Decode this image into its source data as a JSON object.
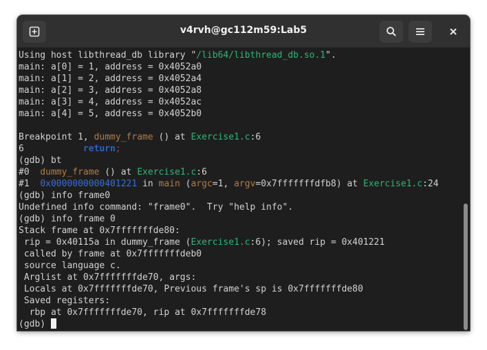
{
  "window": {
    "title": "v4rvh@gc112m59:Lab5",
    "buttons": {
      "new_tab_icon": "new-tab-icon",
      "search_icon": "search-icon",
      "menu_icon": "hamburger-menu-icon",
      "close_icon": "close-icon"
    }
  },
  "colors": {
    "filename": "#2fb57a",
    "function": "#b07d4a",
    "address": "#3a6fd6",
    "keyword": "#2a60c8",
    "terminal_bg": "#1e1e1e"
  },
  "terminal": {
    "lines": [
      [
        {
          "t": "Using host libthread_db library \""
        },
        {
          "t": "/lib64/libthread_db.so.1",
          "c": "green"
        },
        {
          "t": "\"."
        }
      ],
      [
        {
          "t": "main: a[0] = 1, address = 0x4052a0"
        }
      ],
      [
        {
          "t": "main: a[1] = 2, address = 0x4052a4"
        }
      ],
      [
        {
          "t": "main: a[2] = 3, address = 0x4052a8"
        }
      ],
      [
        {
          "t": "main: a[3] = 4, address = 0x4052ac"
        }
      ],
      [
        {
          "t": "main: a[4] = 5, address = 0x4052b0"
        }
      ],
      [
        {
          "t": ""
        }
      ],
      [
        {
          "t": "Breakpoint 1, "
        },
        {
          "t": "dummy_frame",
          "c": "brown"
        },
        {
          "t": " () at "
        },
        {
          "t": "Exercise1.c",
          "c": "green"
        },
        {
          "t": ":6"
        }
      ],
      [
        {
          "t": "6           "
        },
        {
          "t": "return",
          "c": "bold-blue"
        },
        {
          "t": ";",
          "c": "red"
        }
      ],
      [
        {
          "t": "(gdb) bt"
        }
      ],
      [
        {
          "t": "#0  "
        },
        {
          "t": "dummy_frame",
          "c": "brown"
        },
        {
          "t": " () at "
        },
        {
          "t": "Exercise1.c",
          "c": "green"
        },
        {
          "t": ":6"
        }
      ],
      [
        {
          "t": "#1  "
        },
        {
          "t": "0x0000000000401221",
          "c": "blue"
        },
        {
          "t": " in "
        },
        {
          "t": "main",
          "c": "brown"
        },
        {
          "t": " ("
        },
        {
          "t": "argc",
          "c": "brown"
        },
        {
          "t": "=1, "
        },
        {
          "t": "argv",
          "c": "brown"
        },
        {
          "t": "=0x7fffffffdfb8) at "
        },
        {
          "t": "Exercise1.c",
          "c": "green"
        },
        {
          "t": ":24"
        }
      ],
      [
        {
          "t": "(gdb) info frame0"
        }
      ],
      [
        {
          "t": "Undefined info command: \"frame0\".  Try \"help info\"."
        }
      ],
      [
        {
          "t": "(gdb) info frame 0"
        }
      ],
      [
        {
          "t": "Stack frame at 0x7fffffffde80:"
        }
      ],
      [
        {
          "t": " rip = 0x40115a in dummy_frame ("
        },
        {
          "t": "Exercise1.c",
          "c": "green"
        },
        {
          "t": ":6); saved rip = 0x401221"
        }
      ],
      [
        {
          "t": " called by frame at 0x7fffffffdeb0"
        }
      ],
      [
        {
          "t": " source language c."
        }
      ],
      [
        {
          "t": " Arglist at 0x7fffffffde70, args: "
        }
      ],
      [
        {
          "t": " Locals at 0x7fffffffde70, Previous frame's sp is 0x7fffffffde80"
        }
      ],
      [
        {
          "t": " Saved registers:"
        }
      ],
      [
        {
          "t": "  rbp at 0x7fffffffde70, rip at 0x7fffffffde78"
        }
      ],
      [
        {
          "t": "(gdb) "
        }
      ]
    ]
  }
}
